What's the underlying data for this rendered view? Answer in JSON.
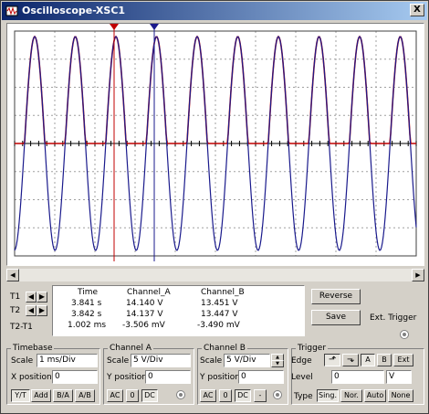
{
  "window": {
    "title": "Oscilloscope-XSC1",
    "close_label": "X"
  },
  "readout": {
    "rows": [
      {
        "label": "T1",
        "time": "3.841 s",
        "channel_a": "14.140 V",
        "channel_b": "13.451 V"
      },
      {
        "label": "T2",
        "time": "3.842 s",
        "channel_a": "14.137 V",
        "channel_b": "13.447 V"
      },
      {
        "label": "T2-T1",
        "time": "1.002 ms",
        "channel_a": "-3.506 mV",
        "channel_b": "-3.490 mV"
      }
    ],
    "headers": {
      "time": "Time",
      "channel_a": "Channel_A",
      "channel_b": "Channel_B"
    }
  },
  "actions": {
    "reverse": "Reverse",
    "save": "Save",
    "ext_trigger": "Ext. Trigger"
  },
  "timebase": {
    "title": "Timebase",
    "scale_label": "Scale",
    "scale_value": "1 ms/Div",
    "xpos_label": "X position",
    "xpos_value": "0",
    "modes": [
      "Y/T",
      "Add",
      "B/A",
      "A/B"
    ],
    "active_mode": "Y/T"
  },
  "channel_a": {
    "title": "Channel A",
    "scale_label": "Scale",
    "scale_value": "5  V/Div",
    "ypos_label": "Y position",
    "ypos_value": "0",
    "coupling": [
      "AC",
      "0",
      "DC"
    ],
    "active_coupling": "DC"
  },
  "channel_b": {
    "title": "Channel B",
    "scale_label": "Scale",
    "scale_value": "5  V/Div",
    "ypos_label": "Y position",
    "ypos_value": "0",
    "coupling": [
      "AC",
      "0",
      "DC",
      "-"
    ],
    "active_coupling": "DC"
  },
  "trigger": {
    "title": "Trigger",
    "edge_label": "Edge",
    "sources": [
      "A",
      "B",
      "Ext"
    ],
    "active_source": "A",
    "level_label": "Level",
    "level_value": "0",
    "level_unit": "V",
    "type_label": "Type",
    "types": [
      "Sing.",
      "Nor.",
      "Auto",
      "None"
    ],
    "active_type": "Sing."
  },
  "colors": {
    "channel_a": "#c00000",
    "channel_b": "#1a1a8c",
    "cursor1": "#c00000",
    "cursor2": "#1a1a8c",
    "titlebar": "#0a246a"
  }
}
